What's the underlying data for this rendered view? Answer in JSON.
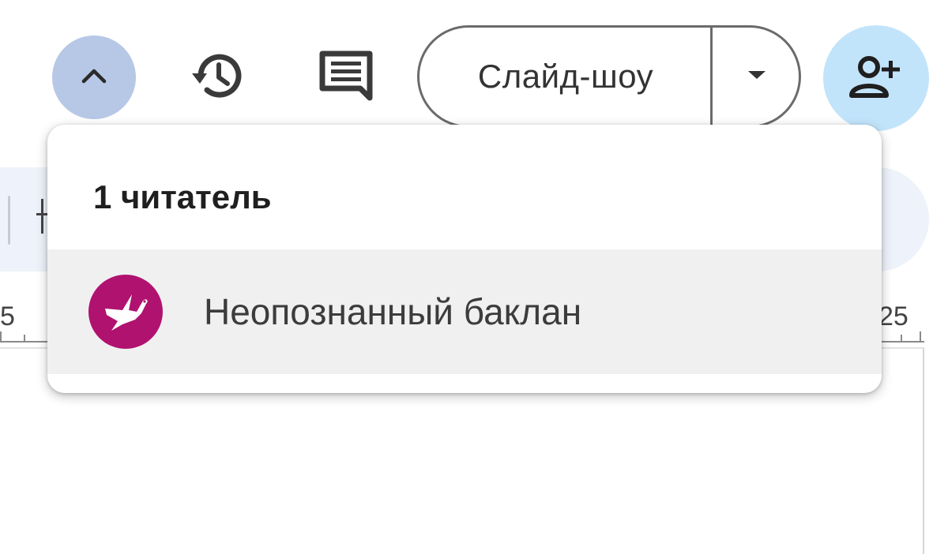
{
  "toolbar": {
    "collapse_icon": "chevron-up-icon",
    "history_icon": "history-icon",
    "comment_icon": "comment-icon",
    "slideshow_label": "Слайд-шоу",
    "slideshow_dropdown_icon": "caret-down-icon",
    "share_icon": "person-add-icon",
    "collapse_bg": "#b7c8e6",
    "share_bg": "#c2e4fb"
  },
  "ruler": {
    "left_number": "5",
    "right_number": "25"
  },
  "popup": {
    "title": "1 читатель",
    "viewers": [
      {
        "name": "Неопознанный баклан",
        "avatar_icon": "cormorant-icon",
        "avatar_color": "#b0126f"
      }
    ]
  }
}
